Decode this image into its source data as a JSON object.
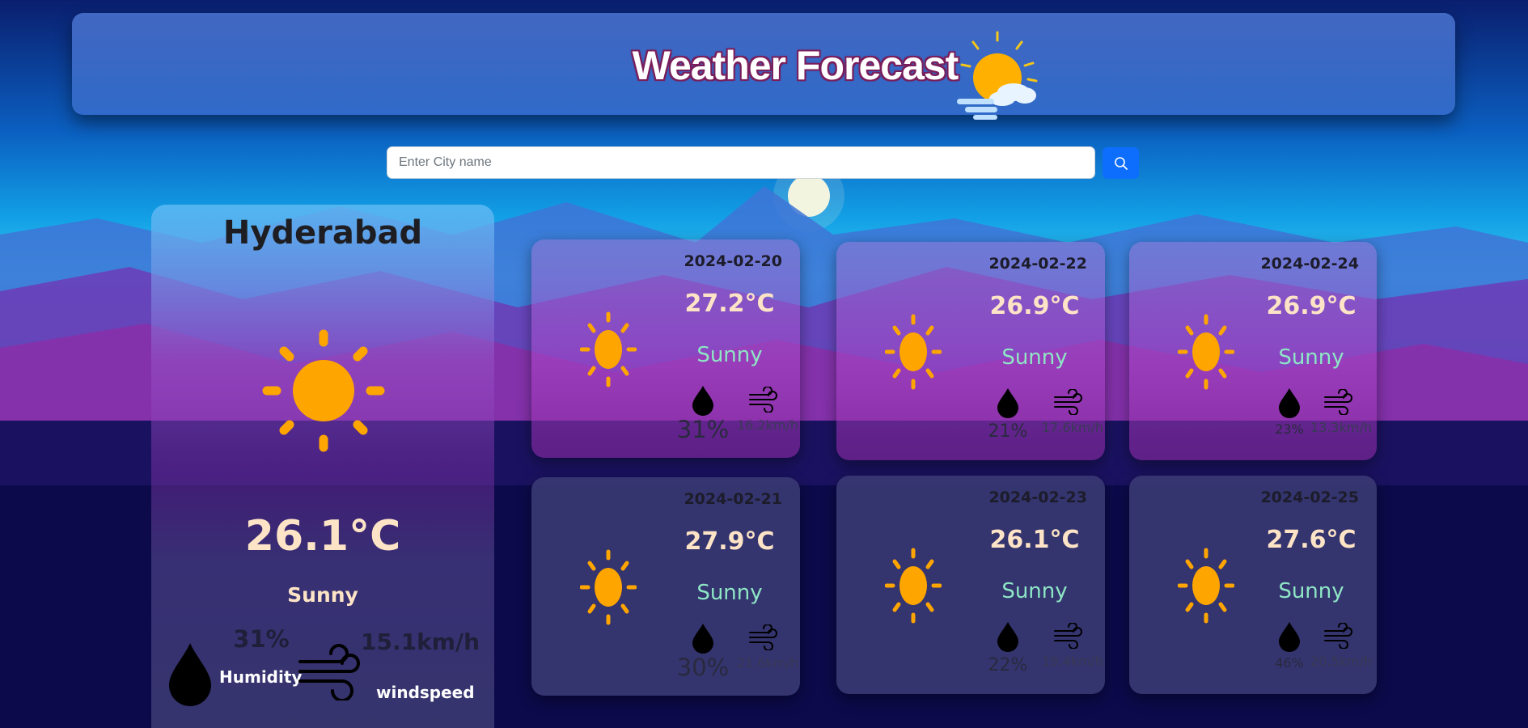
{
  "header": {
    "title": "Weather Forecast",
    "logo_icon": "sun-cloud-icon"
  },
  "search": {
    "placeholder": "Enter City name",
    "value": "",
    "button_icon": "search-icon"
  },
  "current": {
    "city": "Hyderabad",
    "icon": "sun-icon",
    "temperature": "26.1°C",
    "condition": "Sunny",
    "humidity": "31%",
    "humidity_label": "Humidity",
    "wind": "15.1km/h",
    "wind_label": "windspeed"
  },
  "forecast": [
    {
      "date": "2024-02-20",
      "temperature": "27.2°C",
      "condition": "Sunny",
      "humidity": "31%",
      "wind": "16.2km/h"
    },
    {
      "date": "2024-02-21",
      "temperature": "27.9°C",
      "condition": "Sunny",
      "humidity": "30%",
      "wind": "21.6km/h"
    },
    {
      "date": "2024-02-22",
      "temperature": "26.9°C",
      "condition": "Sunny",
      "humidity": "21%",
      "wind": "17.6km/h"
    },
    {
      "date": "2024-02-23",
      "temperature": "26.1°C",
      "condition": "Sunny",
      "humidity": "22%",
      "wind": "19.4km/h"
    },
    {
      "date": "2024-02-24",
      "temperature": "26.9°C",
      "condition": "Sunny",
      "humidity": "23%",
      "wind": "13.3km/h"
    },
    {
      "date": "2024-02-25",
      "temperature": "27.6°C",
      "condition": "Sunny",
      "humidity": "46%",
      "wind": "20.5km/h"
    }
  ],
  "colors": {
    "header": "#3f78c8",
    "search_button": "#0d6efd",
    "sun": "#ffa500",
    "temperature_text": "#fde4c6",
    "condition_text": "#8ee6c5"
  }
}
